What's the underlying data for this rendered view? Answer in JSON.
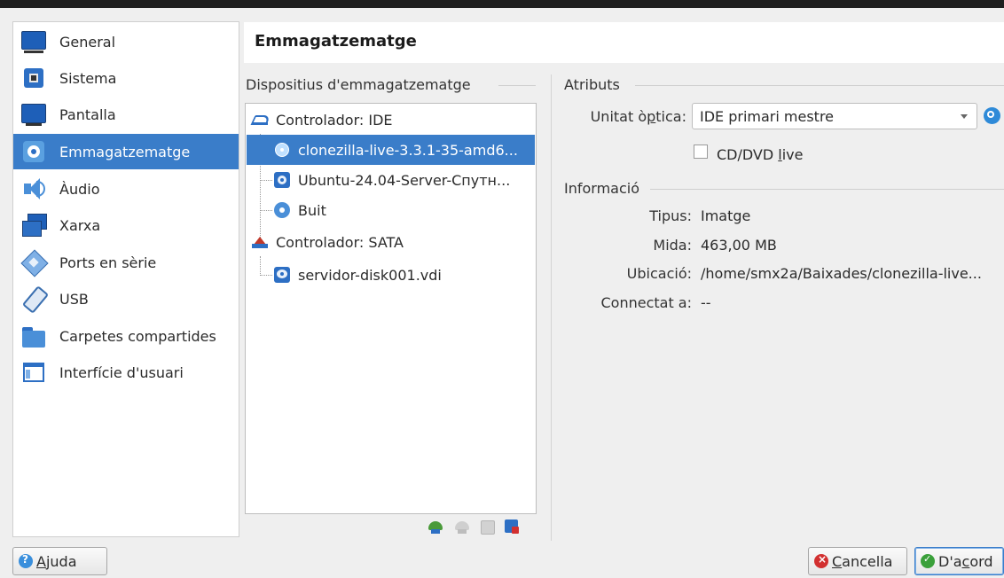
{
  "page_title": "Emmagatzematge",
  "sidebar": {
    "items": [
      {
        "label": "General",
        "icon": "monitor-icon"
      },
      {
        "label": "Sistema",
        "icon": "chip-icon"
      },
      {
        "label": "Pantalla",
        "icon": "display-icon"
      },
      {
        "label": "Emmagatzematge",
        "icon": "disk-icon",
        "selected": true
      },
      {
        "label": "Àudio",
        "icon": "speaker-icon"
      },
      {
        "label": "Xarxa",
        "icon": "network-icon"
      },
      {
        "label": "Ports en sèrie",
        "icon": "serial-port-icon"
      },
      {
        "label": "USB",
        "icon": "usb-icon"
      },
      {
        "label": "Carpetes compartides",
        "icon": "folder-icon"
      },
      {
        "label": "Interfície d'usuari",
        "icon": "window-icon"
      }
    ]
  },
  "storage": {
    "heading": "Dispositius d'emmagatzematge",
    "tree": [
      {
        "label": "Controlador: IDE",
        "type": "controller"
      },
      {
        "label": "clonezilla-live-3.3.1-35-amd6...",
        "type": "optical",
        "selected": true
      },
      {
        "label": "Ubuntu-24.04-Server-Спутн...",
        "type": "optical-image"
      },
      {
        "label": "Buit",
        "type": "optical"
      },
      {
        "label": "Controlador: SATA",
        "type": "controller"
      },
      {
        "label": "servidor-disk001.vdi",
        "type": "hard-disk"
      }
    ]
  },
  "attributes": {
    "heading": "Atributs",
    "optical_label": "Unitat òptica:",
    "optical_value": "IDE primari mestre",
    "live_label": "CD/DVD live",
    "live_checked": false
  },
  "info": {
    "heading": "Informació",
    "rows": [
      {
        "label": "Tipus:",
        "value": "Imatge"
      },
      {
        "label": "Mida:",
        "value": "463,00 MB"
      },
      {
        "label": "Ubicació:",
        "value": "/home/smx2a/Baixades/clonezilla-live..."
      },
      {
        "label": "Connectat a:",
        "value": "--"
      }
    ]
  },
  "buttons": {
    "help": "Ajuda",
    "cancel": "Cancella",
    "ok": "D'acord"
  },
  "colors": {
    "selection": "#3a7dc9",
    "ok_green": "#3aa03a",
    "cancel_red": "#d23030"
  }
}
